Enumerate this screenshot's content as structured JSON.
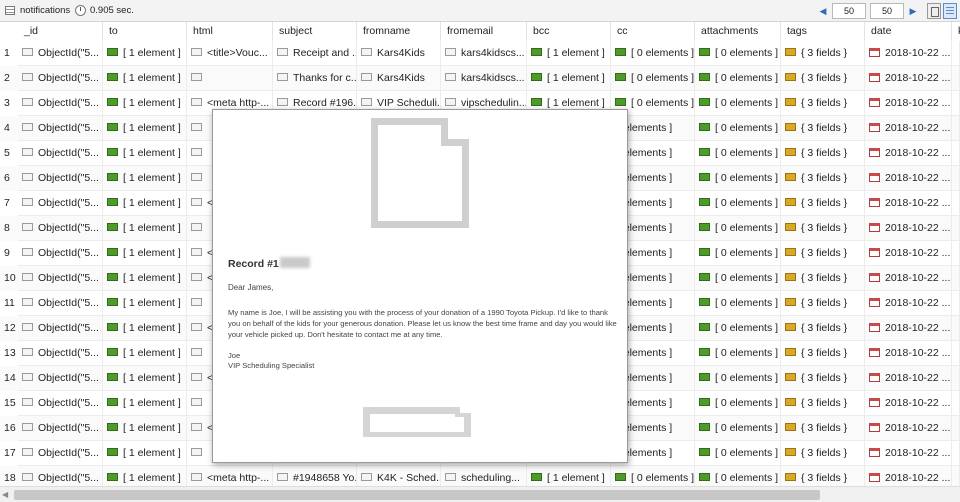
{
  "toolbar": {
    "title": "notifications",
    "time": "0.905 sec.",
    "skip": "50",
    "limit": "50"
  },
  "columns": [
    "_id",
    "to",
    "html",
    "subject",
    "fromname",
    "fromemail",
    "bcc",
    "cc",
    "attachments",
    "tags",
    "date",
    "k"
  ],
  "rows": [
    {
      "num": "1",
      "id": "ObjectId(\"5...",
      "to": "[ 1 element ]",
      "html": "<title>Vouc...",
      "subject": "Receipt and ...",
      "fromname": "Kars4Kids",
      "fromemail": "kars4kidscs...",
      "bcc": "[ 1 element ]",
      "cc": "[ 0 elements ]",
      "attachments": "[ 0 elements ]",
      "tags": "{ 3 fields }",
      "date": "2018-10-22 ..."
    },
    {
      "num": "2",
      "id": "ObjectId(\"5...",
      "to": "[ 1 element ]",
      "html": "",
      "subject": "Thanks for c...",
      "fromname": "Kars4Kids",
      "fromemail": "kars4kidscs...",
      "bcc": "[ 1 element ]",
      "cc": "[ 0 elements ]",
      "attachments": "[ 0 elements ]",
      "tags": "{ 3 fields }",
      "date": "2018-10-22 ..."
    },
    {
      "num": "3",
      "id": "ObjectId(\"5...",
      "to": "[ 1 element ]",
      "html": "<meta http-...",
      "subject": "Record #196...",
      "fromname": "VIP Scheduli...",
      "fromemail": "vipschedulin...",
      "bcc": "[ 1 element ]",
      "cc": "[ 0 elements ]",
      "attachments": "[ 0 elements ]",
      "tags": "{ 3 fields }",
      "date": "2018-10-22 ..."
    },
    {
      "num": "4",
      "id": "ObjectId(\"5...",
      "to": "[ 1 element ]",
      "html": "",
      "subject": "",
      "fromname": "",
      "fromemail": "",
      "bcc": "",
      "cc": "0 elements ]",
      "attachments": "[ 0 elements ]",
      "tags": "{ 3 fields }",
      "date": "2018-10-22 ..."
    },
    {
      "num": "5",
      "id": "ObjectId(\"5...",
      "to": "[ 1 element ]",
      "html": "",
      "subject": "",
      "fromname": "",
      "fromemail": "",
      "bcc": "",
      "cc": "0 elements ]",
      "attachments": "[ 0 elements ]",
      "tags": "{ 3 fields }",
      "date": "2018-10-22 ..."
    },
    {
      "num": "6",
      "id": "ObjectId(\"5...",
      "to": "[ 1 element ]",
      "html": "",
      "subject": "",
      "fromname": "",
      "fromemail": "",
      "bcc": "",
      "cc": "0 elements ]",
      "attachments": "[ 0 elements ]",
      "tags": "{ 3 fields }",
      "date": "2018-10-22 ..."
    },
    {
      "num": "7",
      "id": "ObjectId(\"5...",
      "to": "[ 1 element ]",
      "html": "<",
      "subject": "",
      "fromname": "",
      "fromemail": "",
      "bcc": "",
      "cc": "0 elements ]",
      "attachments": "[ 0 elements ]",
      "tags": "{ 3 fields }",
      "date": "2018-10-22 ..."
    },
    {
      "num": "8",
      "id": "ObjectId(\"5...",
      "to": "[ 1 element ]",
      "html": "",
      "subject": "",
      "fromname": "",
      "fromemail": "",
      "bcc": "",
      "cc": "0 elements ]",
      "attachments": "[ 0 elements ]",
      "tags": "{ 3 fields }",
      "date": "2018-10-22 ..."
    },
    {
      "num": "9",
      "id": "ObjectId(\"5...",
      "to": "[ 1 element ]",
      "html": "<",
      "subject": "",
      "fromname": "",
      "fromemail": "",
      "bcc": "",
      "cc": "0 elements ]",
      "attachments": "[ 0 elements ]",
      "tags": "{ 3 fields }",
      "date": "2018-10-22 ..."
    },
    {
      "num": "10",
      "id": "ObjectId(\"5...",
      "to": "[ 1 element ]",
      "html": "<",
      "subject": "",
      "fromname": "",
      "fromemail": "",
      "bcc": "",
      "cc": "0 elements ]",
      "attachments": "[ 0 elements ]",
      "tags": "{ 3 fields }",
      "date": "2018-10-22 ..."
    },
    {
      "num": "11",
      "id": "ObjectId(\"5...",
      "to": "[ 1 element ]",
      "html": "",
      "subject": "",
      "fromname": "",
      "fromemail": "",
      "bcc": "",
      "cc": "0 elements ]",
      "attachments": "[ 0 elements ]",
      "tags": "{ 3 fields }",
      "date": "2018-10-22 ..."
    },
    {
      "num": "12",
      "id": "ObjectId(\"5...",
      "to": "[ 1 element ]",
      "html": "<",
      "subject": "",
      "fromname": "",
      "fromemail": "",
      "bcc": "",
      "cc": "0 elements ]",
      "attachments": "[ 0 elements ]",
      "tags": "{ 3 fields }",
      "date": "2018-10-22 ..."
    },
    {
      "num": "13",
      "id": "ObjectId(\"5...",
      "to": "[ 1 element ]",
      "html": "",
      "subject": "",
      "fromname": "",
      "fromemail": "",
      "bcc": "",
      "cc": "0 elements ]",
      "attachments": "[ 0 elements ]",
      "tags": "{ 3 fields }",
      "date": "2018-10-22 ..."
    },
    {
      "num": "14",
      "id": "ObjectId(\"5...",
      "to": "[ 1 element ]",
      "html": "<",
      "subject": "",
      "fromname": "",
      "fromemail": "",
      "bcc": "",
      "cc": "0 elements ]",
      "attachments": "[ 0 elements ]",
      "tags": "{ 3 fields }",
      "date": "2018-10-22 ..."
    },
    {
      "num": "15",
      "id": "ObjectId(\"5...",
      "to": "[ 1 element ]",
      "html": "",
      "subject": "",
      "fromname": "",
      "fromemail": "",
      "bcc": "",
      "cc": "0 elements ]",
      "attachments": "[ 0 elements ]",
      "tags": "{ 3 fields }",
      "date": "2018-10-22 ..."
    },
    {
      "num": "16",
      "id": "ObjectId(\"5...",
      "to": "[ 1 element ]",
      "html": "<",
      "subject": "",
      "fromname": "",
      "fromemail": "",
      "bcc": "",
      "cc": "0 elements ]",
      "attachments": "[ 0 elements ]",
      "tags": "{ 3 fields }",
      "date": "2018-10-22 ..."
    },
    {
      "num": "17",
      "id": "ObjectId(\"5...",
      "to": "[ 1 element ]",
      "html": "",
      "subject": "",
      "fromname": "",
      "fromemail": "",
      "bcc": "",
      "cc": "0 elements ]",
      "attachments": "[ 0 elements ]",
      "tags": "{ 3 fields }",
      "date": "2018-10-22 ..."
    },
    {
      "num": "18",
      "id": "ObjectId(\"5...",
      "to": "[ 1 element ]",
      "html": "<meta http-...",
      "subject": "#1948658 Yo...",
      "fromname": "K4K - Sched...",
      "fromemail": "scheduling...",
      "bcc": "[ 1 element ]",
      "cc": "[ 0 elements ]",
      "attachments": "[ 0 elements ]",
      "tags": "{ 3 fields }",
      "date": "2018-10-22 ..."
    }
  ],
  "preview": {
    "heading": "Record #1",
    "greeting": "Dear James,",
    "body": "My name is Joe, I will be assisting you with the process of your donation of a 1990 Toyota Pickup. I'd like to thank you on behalf of the kids for your generous donation. Please let us know the best time frame and day you would like your vehicle picked up. Don't hesitate to contact me at any time.",
    "signature_name": "Joe",
    "signature_title": "VIP Scheduling Specialist"
  },
  "icons": {
    "string": "string-field-icon",
    "array": "array-field-icon",
    "object": "object-field-icon",
    "date": "date-field-icon"
  },
  "colors": {
    "array_icon": "#4e9a2b",
    "object_icon": "#d9a824",
    "date_icon": "#c94a4a",
    "nav_arrow": "#2a6ebb"
  }
}
